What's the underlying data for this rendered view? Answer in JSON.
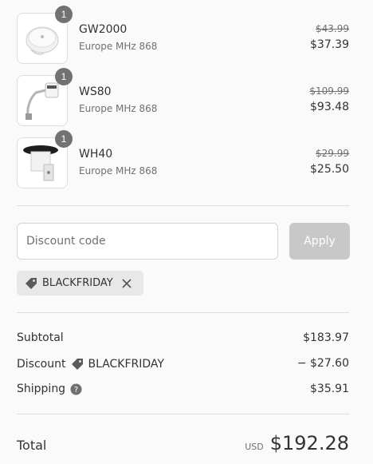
{
  "items": [
    {
      "name": "GW2000",
      "variant": "Europe MHz 868",
      "quantity": "1",
      "price_original": "$43.99",
      "price_final": "$37.39",
      "image_icon": "gateway-device-icon"
    },
    {
      "name": "WS80",
      "variant": "Europe MHz 868",
      "quantity": "1",
      "price_original": "$109.99",
      "price_final": "$93.48",
      "image_icon": "weather-sensor-icon"
    },
    {
      "name": "WH40",
      "variant": "Europe MHz 868",
      "quantity": "1",
      "price_original": "$29.99",
      "price_final": "$25.50",
      "image_icon": "rain-gauge-icon"
    }
  ],
  "discount": {
    "placeholder": "Discount code",
    "apply_label": "Apply",
    "applied_code": "BLACKFRIDAY"
  },
  "summary": {
    "subtotal_label": "Subtotal",
    "subtotal_value": "$183.97",
    "discount_label": "Discount",
    "discount_code": "BLACKFRIDAY",
    "discount_value": "− $27.60",
    "shipping_label": "Shipping",
    "shipping_value": "$35.91"
  },
  "total": {
    "label": "Total",
    "currency": "USD",
    "value": "$192.28"
  },
  "colors": {
    "apply_disabled_bg": "#c8c8c8",
    "tag_bg": "#e8e8e8",
    "quantity_badge": "#727272"
  }
}
